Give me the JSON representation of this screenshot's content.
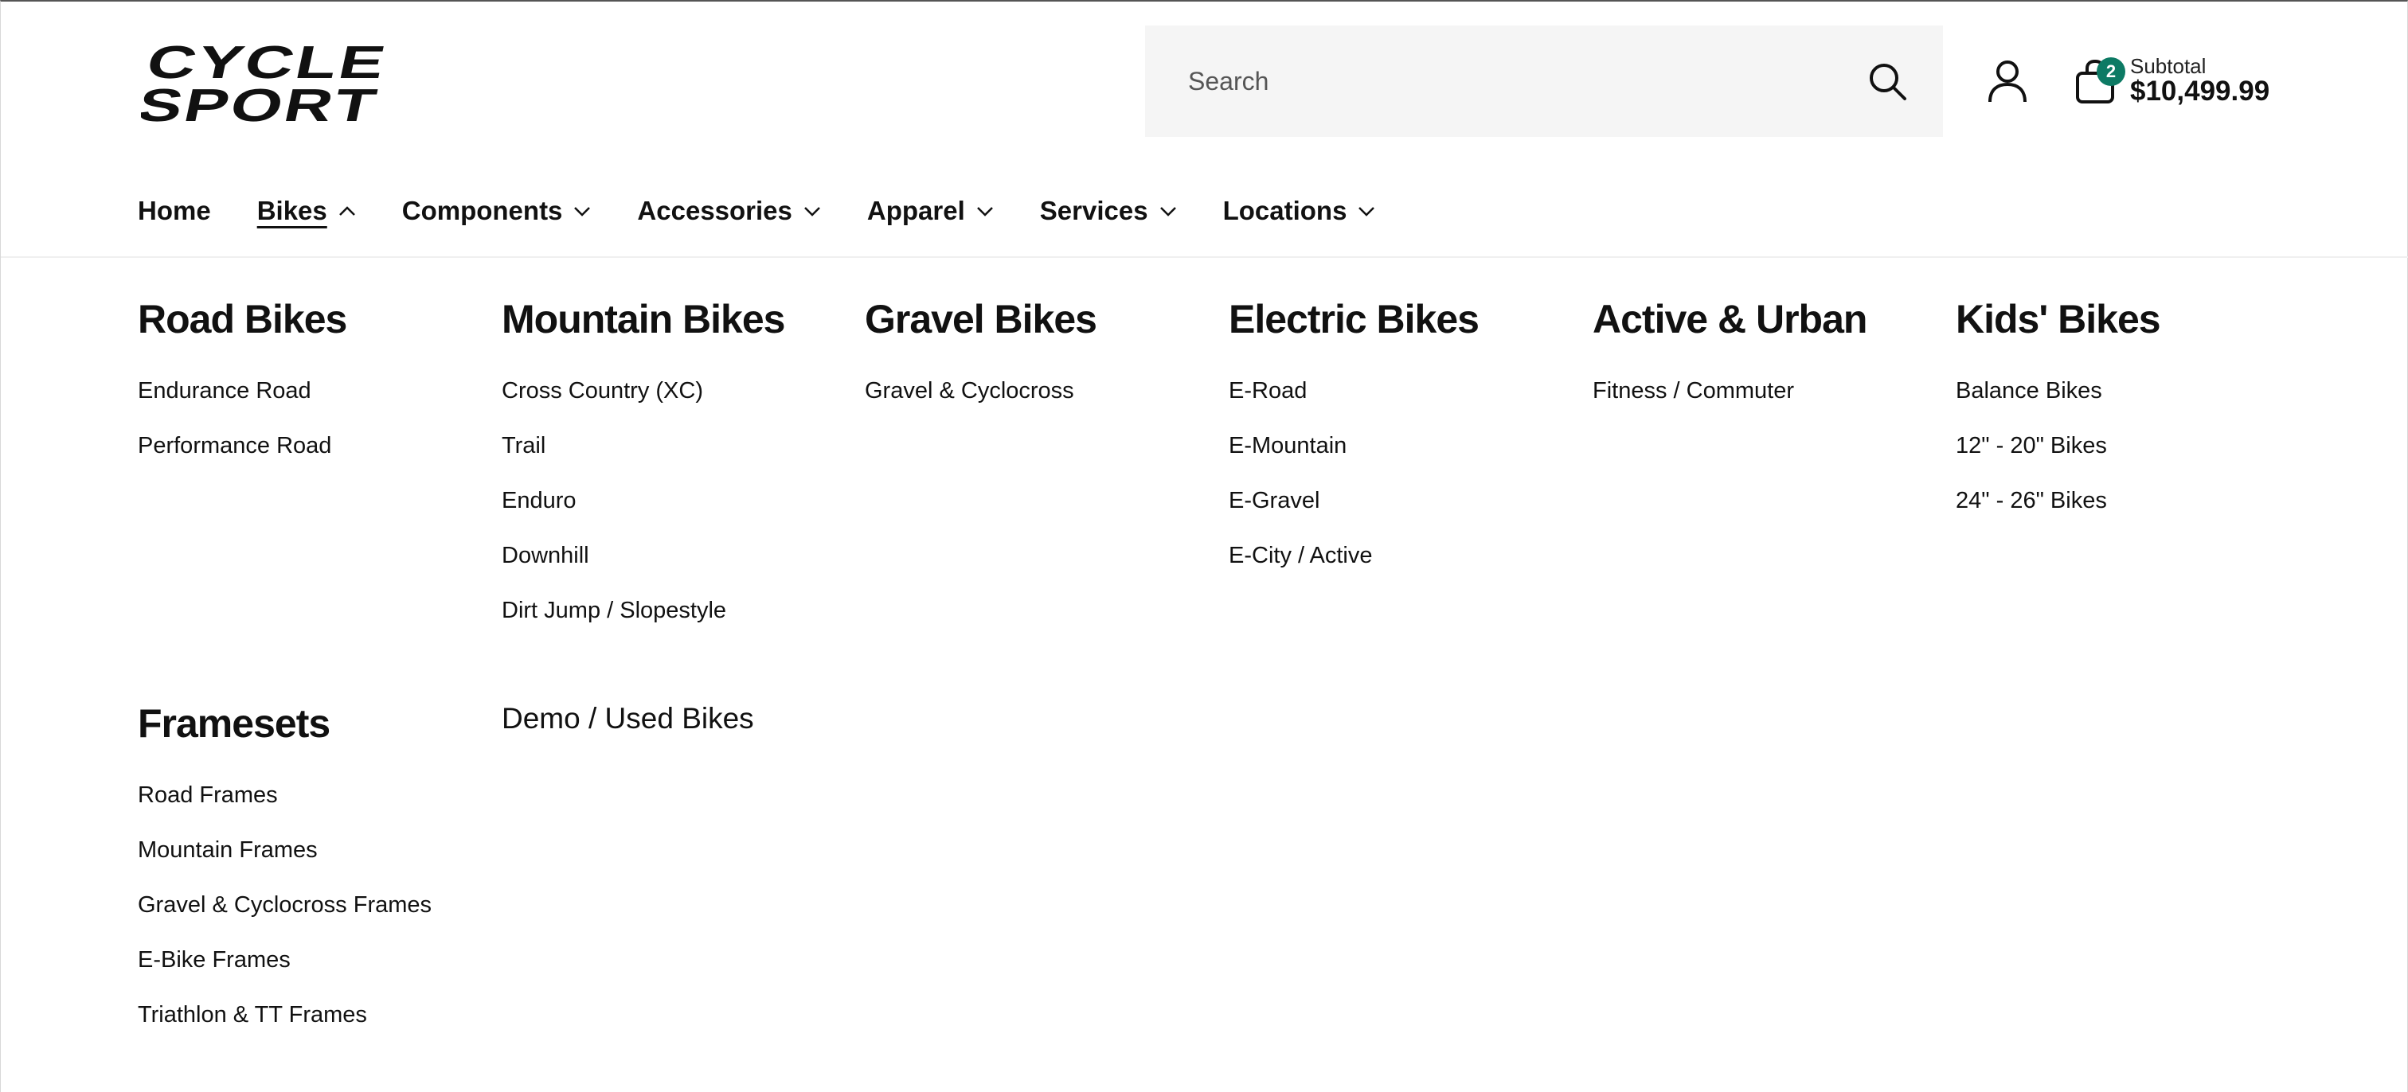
{
  "brand": {
    "logo_text_line1": "CYCLE",
    "logo_text_line2": "SPORT"
  },
  "search": {
    "placeholder": "Search"
  },
  "cart": {
    "count": "2",
    "subtotal_label": "Subtotal",
    "subtotal_value": "$10,499.99"
  },
  "nav": {
    "items": [
      {
        "label": "Home"
      },
      {
        "label": "Bikes"
      },
      {
        "label": "Components"
      },
      {
        "label": "Accessories"
      },
      {
        "label": "Apparel"
      },
      {
        "label": "Services"
      },
      {
        "label": "Locations"
      }
    ]
  },
  "menu": {
    "road": {
      "title": "Road Bikes",
      "links": [
        "Endurance Road",
        "Performance Road"
      ]
    },
    "mountain": {
      "title": "Mountain Bikes",
      "links": [
        "Cross Country (XC)",
        "Trail",
        "Enduro",
        "Downhill",
        "Dirt Jump / Slopestyle"
      ]
    },
    "gravel": {
      "title": "Gravel Bikes",
      "links": [
        "Gravel & Cyclocross"
      ]
    },
    "electric": {
      "title": "Electric Bikes",
      "links": [
        "E-Road",
        "E-Mountain",
        "E-Gravel",
        "E-City / Active"
      ]
    },
    "urban": {
      "title": "Active & Urban",
      "links": [
        "Fitness / Commuter"
      ]
    },
    "kids": {
      "title": "Kids' Bikes",
      "links": [
        "Balance Bikes",
        "12\" - 20\" Bikes",
        "24\" - 26\" Bikes"
      ]
    },
    "framesets": {
      "title": "Framesets",
      "links": [
        "Road Frames",
        "Mountain Frames",
        "Gravel & Cyclocross Frames",
        "E-Bike Frames",
        "Triathlon & TT Frames"
      ]
    },
    "demo": {
      "label": "Demo / Used Bikes"
    }
  },
  "colors": {
    "accent": "#0d7a64",
    "text": "#111111",
    "search_bg": "#f5f5f5"
  },
  "icons": [
    "search-icon",
    "user-icon",
    "bag-icon",
    "chevron-up-icon",
    "chevron-down-icon"
  ]
}
